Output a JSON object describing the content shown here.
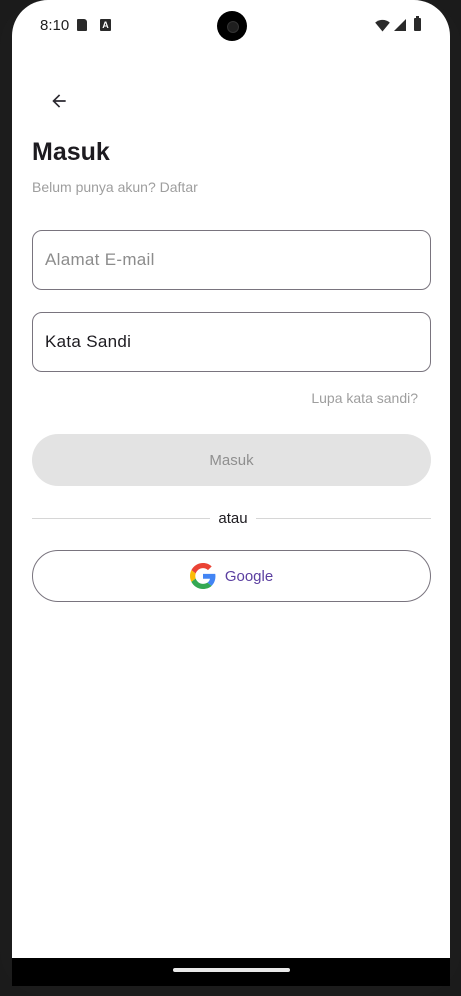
{
  "status_bar": {
    "time": "8:10",
    "icons": [
      "sd-card-icon",
      "app-notification-icon",
      "wifi-icon",
      "signal-icon",
      "battery-icon"
    ]
  },
  "header": {
    "back_icon": "arrow-back-icon",
    "title": "Masuk",
    "subtitle": "Belum punya akun? Daftar"
  },
  "form": {
    "email_placeholder": "Alamat E-mail",
    "email_value": "",
    "password_value": "Kata Sandi",
    "forgot_password": "Lupa kata sandi?",
    "submit_label": "Masuk"
  },
  "divider": {
    "label": "atau"
  },
  "social": {
    "google_label": "Google",
    "google_icon": "google-logo-icon"
  },
  "colors": {
    "accent_text": "#5b3fa0",
    "disabled_button_bg": "#e3e3e3",
    "outline": "#79747e"
  }
}
